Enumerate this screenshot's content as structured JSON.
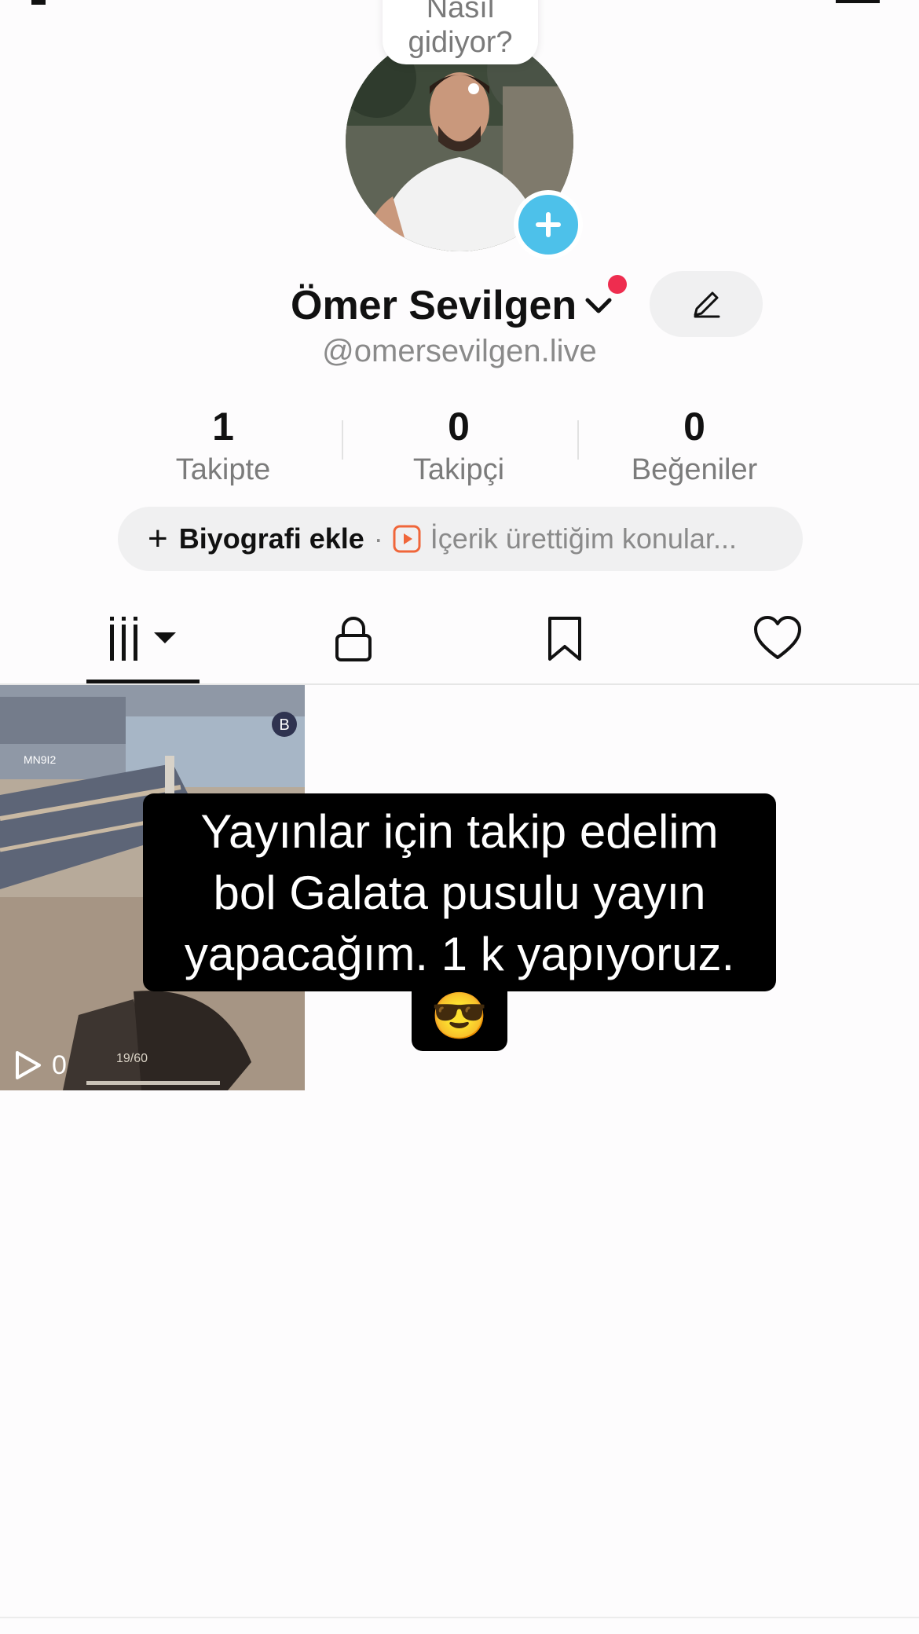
{
  "bubble": {
    "line1": "Nasıl",
    "line2": "gidiyor?"
  },
  "profile": {
    "name": "Ömer Sevilgen",
    "handle": "@omersevilgen.live"
  },
  "stats": [
    {
      "value": "1",
      "label": "Takipte"
    },
    {
      "value": "0",
      "label": "Takipçi"
    },
    {
      "value": "0",
      "label": "Beğeniler"
    }
  ],
  "bio": {
    "add_label": "Biyografi ekle",
    "separator": "·",
    "topics": "İçerik ürettiğim konular..."
  },
  "tabs": [
    {
      "icon": "grid-icon",
      "active": true
    },
    {
      "icon": "lock-icon",
      "active": false
    },
    {
      "icon": "bookmark-icon",
      "active": false
    },
    {
      "icon": "heart-icon",
      "active": false
    }
  ],
  "video": {
    "views": "0",
    "hud_text": "MN9I2",
    "ammo": "19/60"
  },
  "tooltip": {
    "line1": "Yayınlar için takip edelim",
    "line2": "bol Galata pusulu yayın",
    "line3": "yapacağım. 1 k yapıyoruz.",
    "emoji": "😎"
  },
  "colors": {
    "accent_blue": "#4dc1ea",
    "notification_red": "#ee2d4f",
    "play_orange": "#f0663a"
  }
}
